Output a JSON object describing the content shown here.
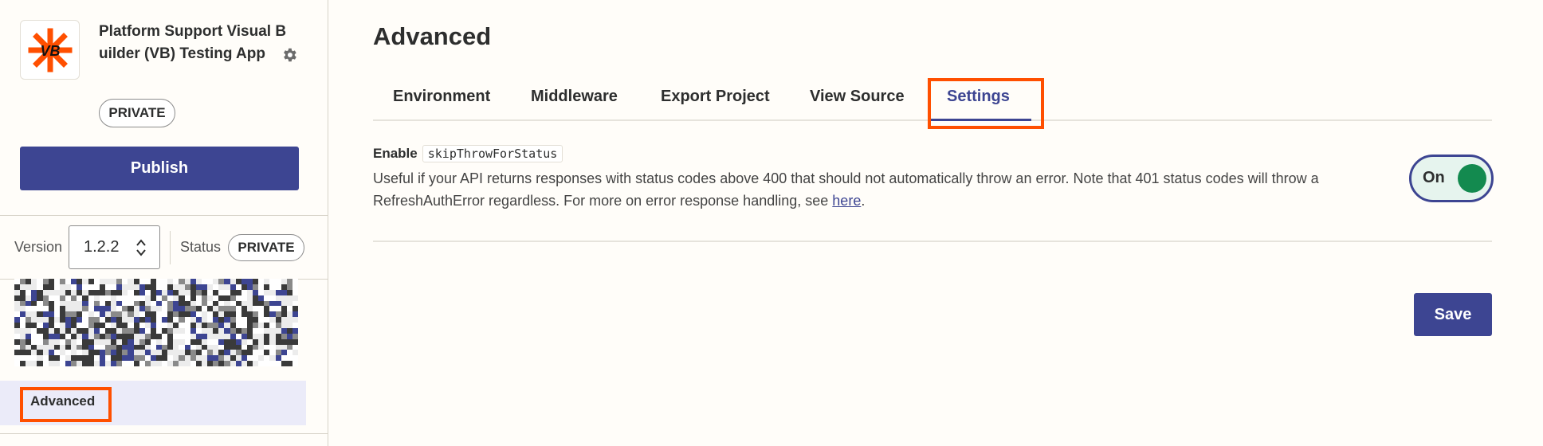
{
  "sidebar": {
    "app_title": "Platform Support Visual Builder (VB) Testing App",
    "logo_text": "VB",
    "privacy_badge": "PRIVATE",
    "publish_label": "Publish",
    "version_label": "Version",
    "version_value": "1.2.2",
    "status_label": "Status",
    "status_badge": "PRIVATE",
    "nav_advanced_label": "Advanced"
  },
  "main": {
    "title": "Advanced",
    "tabs": [
      {
        "label": "Environment"
      },
      {
        "label": "Middleware"
      },
      {
        "label": "Export Project"
      },
      {
        "label": "View Source"
      },
      {
        "label": "Settings"
      }
    ],
    "active_tab": "Settings",
    "setting": {
      "enable_label": "Enable",
      "code": "skipThrowForStatus",
      "description_line1": "Useful if your API returns responses with status codes above 400 that should not automatically throw an error. Note that 401 status codes will throw a",
      "description_line2": "RefreshAuthError regardless. For more on error response handling, see",
      "link_text": "here",
      "trailing": "."
    },
    "toggle_label": "On",
    "save_label": "Save"
  },
  "colors": {
    "accent": "#3d4592",
    "highlight": "#ff4f00",
    "toggle_on": "#138a4f",
    "logo_orange": "#ff4f00"
  },
  "icons": [
    "settings-gear-icon",
    "up-down-chevron-icon",
    "app-logo-icon"
  ]
}
